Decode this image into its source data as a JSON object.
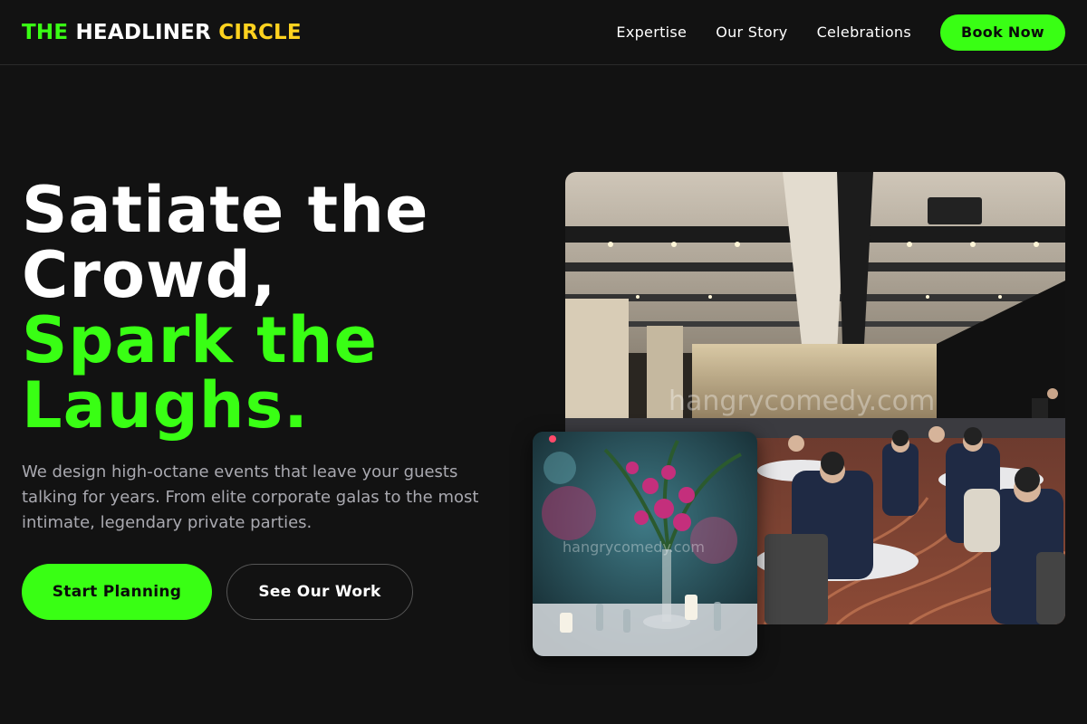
{
  "header": {
    "logo": {
      "part1": "THE",
      "part2": "HEADLINER",
      "part3": "CIRCLE"
    },
    "nav": [
      "Expertise",
      "Our Story",
      "Celebrations"
    ],
    "book_label": "Book Now"
  },
  "hero": {
    "headline_white": [
      "Satiate the",
      "Crowd,"
    ],
    "headline_green": [
      "Spark the",
      "Laughs."
    ],
    "subtext": "We design high-octane events that leave your guests talking for years. From elite corporate galas to the most intimate, legendary private parties.",
    "cta_primary": "Start Planning",
    "cta_secondary": "See Our Work"
  },
  "images": {
    "main_watermark": "hangrycomedy.com",
    "small_watermark": "hangrycomedy.com"
  },
  "colors": {
    "background": "#121212",
    "accent_green": "#39ff14",
    "accent_yellow": "#ffd21f",
    "muted_text": "#a9a9b0"
  }
}
